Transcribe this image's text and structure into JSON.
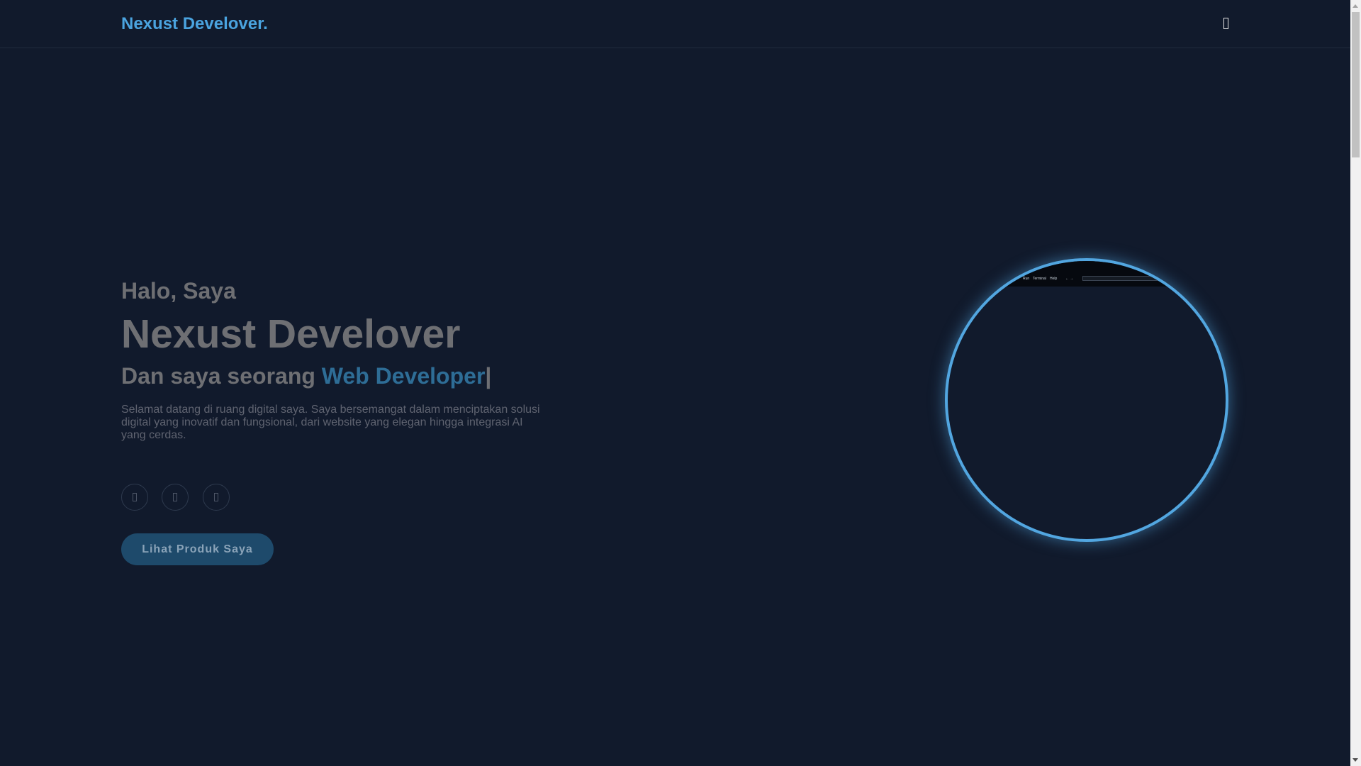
{
  "header": {
    "logo": "Nexust Develover.",
    "menu_icon": "menu-icon"
  },
  "hero": {
    "greeting": "Halo, Saya",
    "name": "Nexust Develover",
    "role_prefix": "Dan saya seorang",
    "role_highlight": "Web Developer",
    "role_cursor": "|",
    "description": "Selamat datang di ruang digital saya. Saya bersemangat dalam menciptakan solusi digital yang inovatif dan fungsional, dari website yang elegan hingga integrasi AI yang cerdas.",
    "social_icons": [
      "social-icon-1",
      "social-icon-2",
      "social-icon-3"
    ],
    "cta_label": "Lihat Produk Saya"
  },
  "profile": {
    "image": "profile-image",
    "mini_menu": [
      "Run",
      "Terminal",
      "Help",
      "← →"
    ]
  },
  "colors": {
    "background": "#111a2c",
    "accent": "#4aa3df",
    "ring": "#52a6e0",
    "highlight": "#2e6d96",
    "button": "#1e4a6b"
  }
}
